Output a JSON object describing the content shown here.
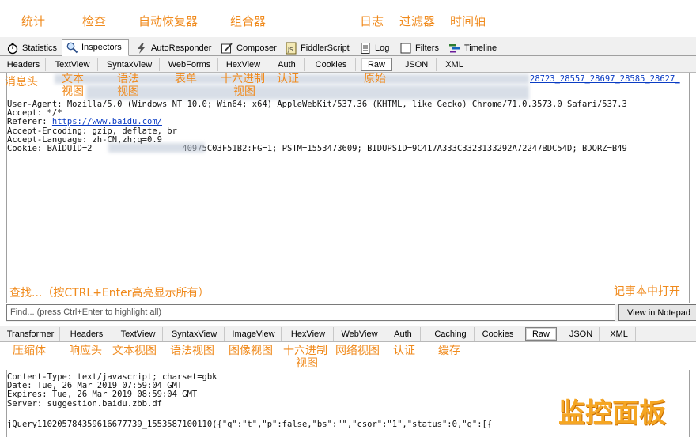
{
  "annotations": {
    "statistics": "统计",
    "inspectors": "检查",
    "autoresponder": "自动恢复器",
    "composer": "组合器",
    "log": "日志",
    "filters": "过滤器",
    "timeline": "时间轴",
    "headers": "消息头",
    "textview_1": "文本",
    "textview_2": "视图",
    "syntax_1": "语法",
    "syntax_2": "视图",
    "webforms": "表单",
    "hex_1": "十六进制",
    "hex_2": "视图",
    "auth": "认证",
    "raw": "原始",
    "find": "查找...（按CTRL+Enter高亮显示所有）",
    "notepad": "记事本中打开",
    "transformer": "压缩体",
    "resp_headers": "响应头",
    "resp_textview": "文本视图",
    "resp_syntax": "语法视图",
    "resp_image": "图像视图",
    "resp_hex_1": "十六进制",
    "resp_hex_2": "视图",
    "resp_web": "网络视图",
    "resp_auth": "认证",
    "caching": "缓存",
    "watermark": "监控面板"
  },
  "main_tabs": [
    {
      "label": "Statistics",
      "icon": "stopwatch-icon"
    },
    {
      "label": "Inspectors",
      "icon": "magnifier-icon",
      "active": true
    },
    {
      "label": "AutoResponder",
      "icon": "lightning-icon"
    },
    {
      "label": "Composer",
      "icon": "pencil-icon"
    },
    {
      "label": "FiddlerScript",
      "icon": "js-script-icon"
    },
    {
      "label": "Log",
      "icon": "document-icon"
    },
    {
      "label": "Filters",
      "icon": "checkbox-icon"
    },
    {
      "label": "Timeline",
      "icon": "timeline-icon"
    }
  ],
  "request_tabs": [
    "Headers",
    "TextView",
    "SyntaxView",
    "WebForms",
    "HexView",
    "Auth",
    "Cookies",
    "Raw",
    "JSON",
    "XML"
  ],
  "request_selected": "Raw",
  "request_text": {
    "link_tail": "28723_28557_28697_28585_28627_",
    "line_ua": "User-Agent: Mozilla/5.0 (Windows NT 10.0; Win64; x64) AppleWebKit/537.36 (KHTML, like Gecko) Chrome/71.0.3573.0 Safari/537.3",
    "line_accept": "Accept: */*",
    "line_referer_label": "Referer: ",
    "line_referer_url": "https://www.baidu.com/",
    "line_encoding": "Accept-Encoding: gzip, deflate, br",
    "line_language": "Accept-Language: zh-CN,zh;q=0.9",
    "line_cookie": "Cookie: BAIDUID=2                  40975C03F51B2:FG=1; PSTM=1553473609; BIDUPSID=9C417A333C3323133292A72247BDC54D; BDORZ=B49"
  },
  "find_placeholder": "Find... (press Ctrl+Enter to highlight all)",
  "notepad_button": "View in Notepad",
  "response_tabs": [
    "Transformer",
    "Headers",
    "TextView",
    "SyntaxView",
    "ImageView",
    "HexView",
    "WebView",
    "Auth",
    "Caching",
    "Cookies",
    "Raw",
    "JSON",
    "XML"
  ],
  "response_selected": "Raw",
  "response_text": {
    "line_ct": "Content-Type: text/javascript; charset=gbk",
    "line_date": "Date: Tue, 26 Mar 2019 07:59:04 GMT",
    "line_expires": "Expires: Tue, 26 Mar 2019 08:59:04 GMT",
    "line_server": "Server: suggestion.baidu.zbb.df",
    "line_body": "jQuery110205784359616677739_1553587100110({\"q\":\"t\",\"p\":false,\"bs\":\"\",\"csor\":\"1\",\"status\":0,\"g\":[{"
  },
  "colors": {
    "annotation": "#f08a1c",
    "link": "#0a3cc4"
  }
}
